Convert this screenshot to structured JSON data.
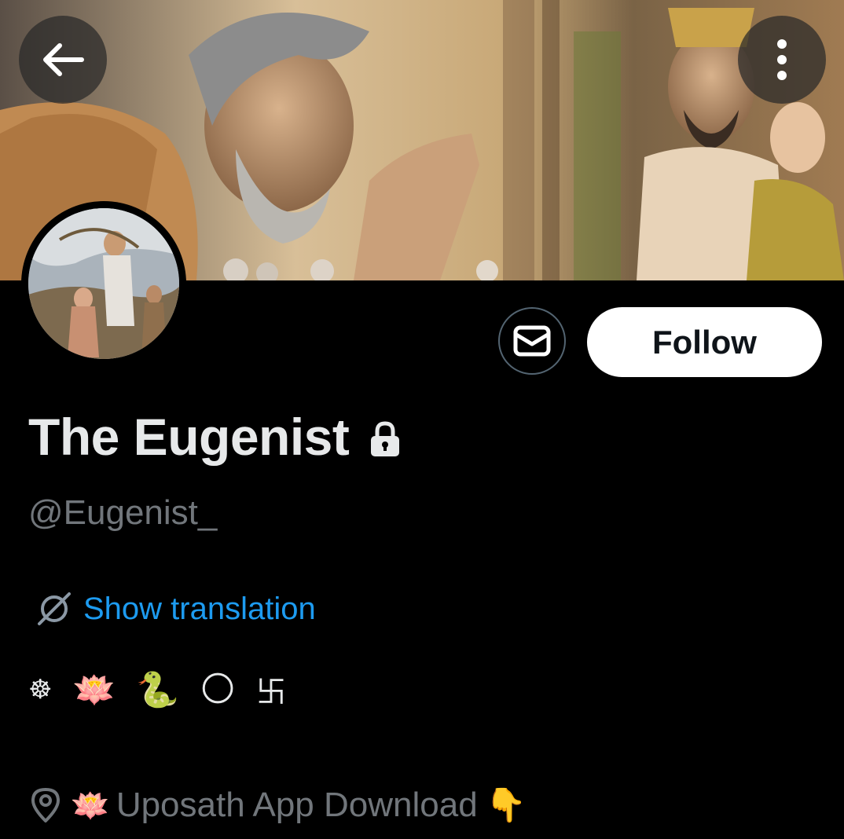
{
  "header": {
    "back_icon": "arrow-left-icon",
    "more_icon": "more-vertical-icon"
  },
  "profile": {
    "display_name": "The Eugenist",
    "protected_icon": "lock-icon",
    "handle": "@Eugenist_",
    "follow_label": "Follow",
    "message_icon": "envelope-icon",
    "translation_label": "Show translation",
    "translation_icon": "translate-icon",
    "bio_emojis": [
      "☸",
      "🪷",
      "🐍",
      "🌕",
      "卐"
    ],
    "location_icon": "location-pin-icon",
    "location_emoji": "🪷",
    "location_text": "Uposath App Download",
    "location_trailing_emoji": "👇"
  },
  "colors": {
    "background": "#000000",
    "accent": "#1d9bf0",
    "secondary_text": "#71767b",
    "primary_text": "#e7e9ea"
  }
}
